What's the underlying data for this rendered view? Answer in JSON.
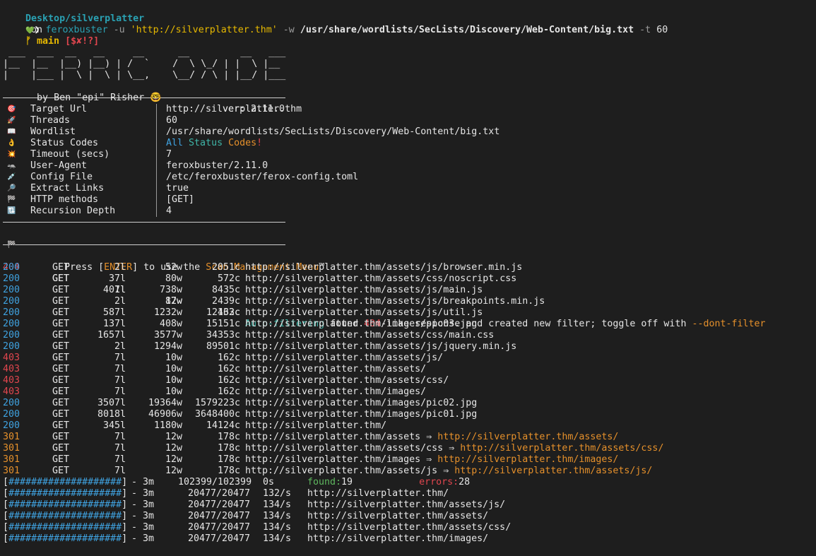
{
  "prompt": {
    "path": "Desktop/silverplatter",
    "on": "on",
    "branch_glyph": "ᚠ",
    "branch": "main",
    "status": "[$✘!?]",
    "heart": "💚",
    "arrow": "❯",
    "command": {
      "bin": "feroxbuster",
      "flag_u": "-u",
      "url": "'http://silverplatter.thm'",
      "flag_w": "-w",
      "wordlist": "/usr/share/wordlists/SecLists/Discovery/Web-Content/big.txt",
      "flag_t": "-t",
      "threads": "60"
    }
  },
  "banner": {
    "art": [
      " ___  ___  __   __     __      __         __   ___",
      "|__  |__  |__) |__) | /  `    /  \\ \\_/ | |  \\ |__",
      "|    |___ |  \\ |  \\ | \\__,    \\__/ / \\ | |__/ |___"
    ],
    "author": "by Ben \"epi\" Risher 🤓",
    "version": "ver: 2.11.0"
  },
  "config": [
    {
      "icon": "🎯",
      "icon_name": "target-icon",
      "key": "Target Url",
      "value": "http://silverplatter.thm"
    },
    {
      "icon": "🚀",
      "icon_name": "rocket-icon",
      "key": "Threads",
      "value": "60"
    },
    {
      "icon": "📖",
      "icon_name": "book-icon",
      "key": "Wordlist",
      "value": "/usr/share/wordlists/SecLists/Discovery/Web-Content/big.txt"
    },
    {
      "icon": "👌",
      "icon_name": "ok-hand-icon",
      "key": "Status Codes",
      "value": null
    },
    {
      "icon": "💥",
      "icon_name": "timeout-icon",
      "key": "Timeout (secs)",
      "value": "7"
    },
    {
      "icon": "🦡",
      "icon_name": "badger-icon",
      "key": "User-Agent",
      "value": "feroxbuster/2.11.0"
    },
    {
      "icon": "💉",
      "icon_name": "syringe-icon",
      "key": "Config File",
      "value": "/etc/feroxbuster/ferox-config.toml"
    },
    {
      "icon": "🔎",
      "icon_name": "magnifier-icon",
      "key": "Extract Links",
      "value": "true"
    },
    {
      "icon": "🏁",
      "icon_name": "flag-icon",
      "key": "HTTP methods",
      "value": "[GET]"
    },
    {
      "icon": "🔃",
      "icon_name": "recursion-icon",
      "key": "Recursion Depth",
      "value": "4"
    }
  ],
  "status_codes": {
    "all": "All",
    "status": "Status",
    "codes": "Codes",
    "bang": "!"
  },
  "press": {
    "icon": "🏁",
    "text1": "Press [",
    "enter": "ENTER",
    "text2": "] to use the ",
    "menu": "Scan Management Menu",
    "tm": "™"
  },
  "filter_row": {
    "status": "404",
    "method": "GET",
    "lines": "7l",
    "words": "12w",
    "chars": "162c",
    "auto": "Auto-filtering",
    "found": " found ",
    "code": "404",
    "rest": "-like response and created new filter; toggle off with ",
    "flag": "--dont-filter"
  },
  "results": [
    {
      "status": "200",
      "method": "GET",
      "lines": "2l",
      "words": "52w",
      "chars": "2051c",
      "url": "http://silverplatter.thm/assets/js/browser.min.js"
    },
    {
      "status": "200",
      "method": "GET",
      "lines": "37l",
      "words": "80w",
      "chars": "572c",
      "url": "http://silverplatter.thm/assets/css/noscript.css"
    },
    {
      "status": "200",
      "method": "GET",
      "lines": "401l",
      "words": "738w",
      "chars": "8435c",
      "url": "http://silverplatter.thm/assets/js/main.js"
    },
    {
      "status": "200",
      "method": "GET",
      "lines": "2l",
      "words": "87w",
      "chars": "2439c",
      "url": "http://silverplatter.thm/assets/js/breakpoints.min.js"
    },
    {
      "status": "200",
      "method": "GET",
      "lines": "587l",
      "words": "1232w",
      "chars": "12433c",
      "url": "http://silverplatter.thm/assets/js/util.js"
    },
    {
      "status": "200",
      "method": "GET",
      "lines": "137l",
      "words": "408w",
      "chars": "15151c",
      "url": "http://silverplatter.thm/images/pic03.jpg"
    },
    {
      "status": "200",
      "method": "GET",
      "lines": "1657l",
      "words": "3577w",
      "chars": "34353c",
      "url": "http://silverplatter.thm/assets/css/main.css"
    },
    {
      "status": "200",
      "method": "GET",
      "lines": "2l",
      "words": "1294w",
      "chars": "89501c",
      "url": "http://silverplatter.thm/assets/js/jquery.min.js"
    },
    {
      "status": "403",
      "method": "GET",
      "lines": "7l",
      "words": "10w",
      "chars": "162c",
      "url": "http://silverplatter.thm/assets/js/"
    },
    {
      "status": "403",
      "method": "GET",
      "lines": "7l",
      "words": "10w",
      "chars": "162c",
      "url": "http://silverplatter.thm/assets/"
    },
    {
      "status": "403",
      "method": "GET",
      "lines": "7l",
      "words": "10w",
      "chars": "162c",
      "url": "http://silverplatter.thm/assets/css/"
    },
    {
      "status": "403",
      "method": "GET",
      "lines": "7l",
      "words": "10w",
      "chars": "162c",
      "url": "http://silverplatter.thm/images/"
    },
    {
      "status": "200",
      "method": "GET",
      "lines": "3507l",
      "words": "19364w",
      "chars": "1579223c",
      "url": "http://silverplatter.thm/images/pic02.jpg"
    },
    {
      "status": "200",
      "method": "GET",
      "lines": "8018l",
      "words": "46906w",
      "chars": "3648400c",
      "url": "http://silverplatter.thm/images/pic01.jpg"
    },
    {
      "status": "200",
      "method": "GET",
      "lines": "345l",
      "words": "1180w",
      "chars": "14124c",
      "url": "http://silverplatter.thm/"
    },
    {
      "status": "301",
      "method": "GET",
      "lines": "7l",
      "words": "12w",
      "chars": "178c",
      "url": "http://silverplatter.thm/assets",
      "redirect": "http://silverplatter.thm/assets/"
    },
    {
      "status": "301",
      "method": "GET",
      "lines": "7l",
      "words": "12w",
      "chars": "178c",
      "url": "http://silverplatter.thm/assets/css",
      "redirect": "http://silverplatter.thm/assets/css/"
    },
    {
      "status": "301",
      "method": "GET",
      "lines": "7l",
      "words": "12w",
      "chars": "178c",
      "url": "http://silverplatter.thm/images",
      "redirect": "http://silverplatter.thm/images/"
    },
    {
      "status": "301",
      "method": "GET",
      "lines": "7l",
      "words": "12w",
      "chars": "178c",
      "url": "http://silverplatter.thm/assets/js",
      "redirect": "http://silverplatter.thm/assets/js/"
    }
  ],
  "redirect_arrow": "⇒",
  "progress": [
    {
      "bar": "####################",
      "time": "- 3m",
      "count": "102399/102399",
      "rate": "0s",
      "found_label": "found:",
      "found": "19",
      "errors_label": "errors:",
      "errors": "28"
    },
    {
      "bar": "####################",
      "time": "- 3m",
      "count": "20477/20477",
      "rate": "132/s",
      "url": "http://silverplatter.thm/"
    },
    {
      "bar": "####################",
      "time": "- 3m",
      "count": "20477/20477",
      "rate": "134/s",
      "url": "http://silverplatter.thm/assets/js/"
    },
    {
      "bar": "####################",
      "time": "- 3m",
      "count": "20477/20477",
      "rate": "134/s",
      "url": "http://silverplatter.thm/assets/"
    },
    {
      "bar": "####################",
      "time": "- 3m",
      "count": "20477/20477",
      "rate": "134/s",
      "url": "http://silverplatter.thm/assets/css/"
    },
    {
      "bar": "####################",
      "time": "- 3m",
      "count": "20477/20477",
      "rate": "134/s",
      "url": "http://silverplatter.thm/images/"
    }
  ],
  "colors": {
    "background": "#1e1e1e",
    "status_200": "#3fa2e0",
    "status_301": "#e5902b",
    "status_403": "#e0464e",
    "status_404": "#e0464e",
    "accent_orange": "#e5902b",
    "accent_teal": "#3fb6a8"
  }
}
